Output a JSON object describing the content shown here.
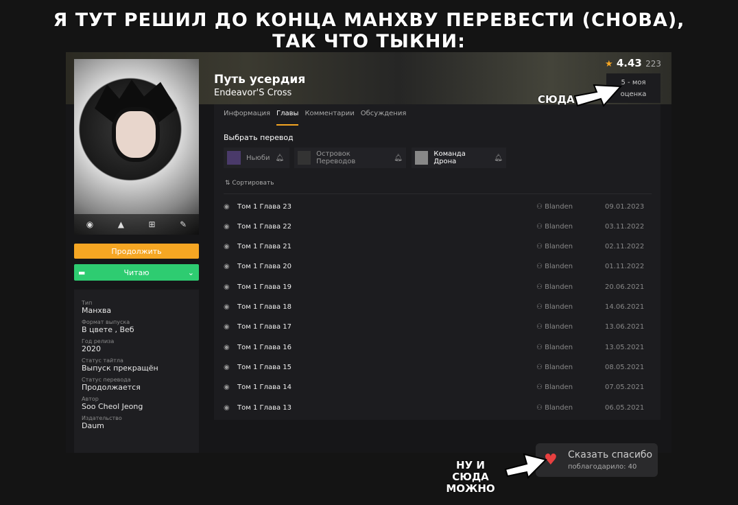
{
  "caption": {
    "line1": "Я ТУТ РЕШИЛ ДО КОНЦА МАНХВУ ПЕРЕВЕСТИ (СНОВА),",
    "line2": "ТАК ЧТО ТЫКНИ:"
  },
  "annotations": {
    "here": "СЮДА",
    "here_too_1": "НУ И СЮДА",
    "here_too_2": "МОЖНО"
  },
  "title": {
    "main": "Путь усердия",
    "alt": "Endeavor'S Cross"
  },
  "rating": {
    "value": "4.43",
    "count": "223",
    "my_rating": "5 - моя",
    "my_rating_2": "оценка"
  },
  "buttons": {
    "continue": "Продолжить",
    "reading": "Читаю"
  },
  "info": [
    {
      "k": "Тип",
      "v": "Манхва"
    },
    {
      "k": "Формат выпуска",
      "v": "В цвете , Веб"
    },
    {
      "k": "Год релиза",
      "v": "2020"
    },
    {
      "k": "Статус тайтла",
      "v": "Выпуск прекращён"
    },
    {
      "k": "Статус перевода",
      "v": "Продолжается"
    },
    {
      "k": "Автор",
      "v": "Soo Cheol Jeong"
    },
    {
      "k": "Издательство",
      "v": "Daum"
    }
  ],
  "tabs": [
    "Информация",
    "Главы",
    "Комментарии",
    "Обсуждения"
  ],
  "select_translation": "Выбрать перевод",
  "translators": [
    "Ньюби",
    "Островок Переводов",
    "Команда Дрона"
  ],
  "sort": "Сортировать",
  "chapters": [
    {
      "name": "Том 1 Глава 23",
      "user": "Blanden",
      "date": "09.01.2023"
    },
    {
      "name": "Том 1 Глава 22",
      "user": "Blanden",
      "date": "03.11.2022"
    },
    {
      "name": "Том 1 Глава 21",
      "user": "Blanden",
      "date": "02.11.2022"
    },
    {
      "name": "Том 1 Глава 20",
      "user": "Blanden",
      "date": "01.11.2022"
    },
    {
      "name": "Том 1 Глава 19",
      "user": "Blanden",
      "date": "20.06.2021"
    },
    {
      "name": "Том 1 Глава 18",
      "user": "Blanden",
      "date": "14.06.2021"
    },
    {
      "name": "Том 1 Глава 17",
      "user": "Blanden",
      "date": "13.06.2021"
    },
    {
      "name": "Том 1 Глава 16",
      "user": "Blanden",
      "date": "13.05.2021"
    },
    {
      "name": "Том 1 Глава 15",
      "user": "Blanden",
      "date": "08.05.2021"
    },
    {
      "name": "Том 1 Глава 14",
      "user": "Blanden",
      "date": "07.05.2021"
    },
    {
      "name": "Том 1 Глава 13",
      "user": "Blanden",
      "date": "06.05.2021"
    }
  ],
  "thanks": {
    "label": "Сказать спасибо",
    "count": "поблагодарило: 40"
  },
  "colors": {
    "accent": "#f5a623",
    "reading": "#2ecc71",
    "heart": "#e84040"
  }
}
